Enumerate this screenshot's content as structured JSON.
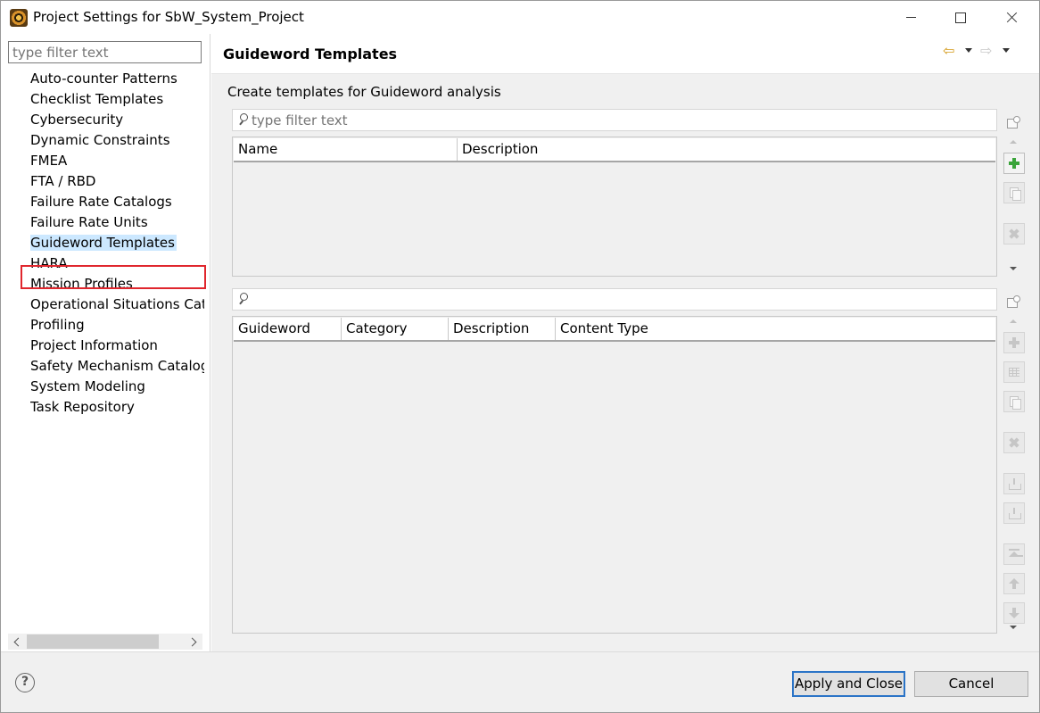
{
  "window": {
    "title": "Project Settings for SbW_System_Project"
  },
  "sidebar": {
    "filter_placeholder": "type filter text",
    "items": [
      {
        "label": "Auto-counter Patterns",
        "expandable": false
      },
      {
        "label": "Checklist Templates",
        "expandable": false
      },
      {
        "label": "Cybersecurity",
        "expandable": true
      },
      {
        "label": "Dynamic Constraints",
        "expandable": false
      },
      {
        "label": "FMEA",
        "expandable": true
      },
      {
        "label": "FTA / RBD",
        "expandable": true
      },
      {
        "label": "Failure Rate Catalogs",
        "expandable": false
      },
      {
        "label": "Failure Rate Units",
        "expandable": false
      },
      {
        "label": "Guideword Templates",
        "expandable": false,
        "selected": true
      },
      {
        "label": "HARA",
        "expandable": false
      },
      {
        "label": "Mission Profiles",
        "expandable": false
      },
      {
        "label": "Operational Situations Cata",
        "expandable": false
      },
      {
        "label": "Profiling",
        "expandable": false
      },
      {
        "label": "Project Information",
        "expandable": false
      },
      {
        "label": "Safety Mechanism Catalog",
        "expandable": false
      },
      {
        "label": "System Modeling",
        "expandable": false
      },
      {
        "label": "Task Repository",
        "expandable": false
      }
    ]
  },
  "page": {
    "title": "Guideword Templates",
    "description": "Create templates for Guideword analysis",
    "templates_filter_placeholder": "type filter text",
    "templates_columns": [
      "Name",
      "Description"
    ],
    "guidewords_filter_value": "",
    "guidewords_columns": [
      "Guideword",
      "Category",
      "Description",
      "Content Type"
    ]
  },
  "icons": {
    "back": "back-arrow-icon",
    "forward": "forward-arrow-icon",
    "add": "add-icon",
    "copy": "copy-icon",
    "delete": "delete-icon"
  },
  "colors": {
    "accent": "#2b74c7",
    "selection_highlight": "#cce8ff",
    "annotation_box": "#e0262d",
    "add_enabled": "#3aa43a"
  },
  "footer": {
    "help_glyph": "?",
    "apply_label": "Apply and Close",
    "cancel_label": "Cancel"
  },
  "glyphs": {
    "back": "⇦",
    "forward": "⇨"
  }
}
